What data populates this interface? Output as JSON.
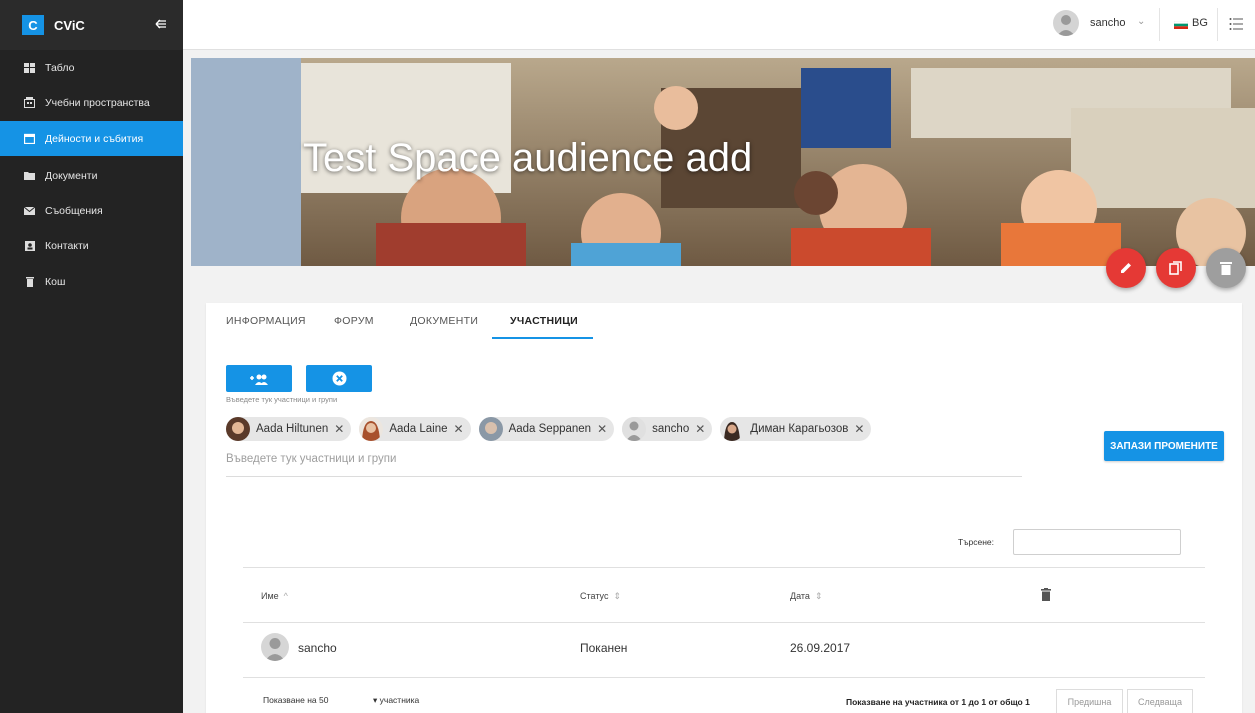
{
  "app": {
    "logo_letter": "C",
    "brand": "CViC"
  },
  "sidebar": {
    "items": [
      {
        "label": "Табло",
        "icon": "dashboard-icon"
      },
      {
        "label": "Учебни пространства",
        "icon": "building-icon"
      },
      {
        "label": "Дейности и събития",
        "icon": "calendar-icon",
        "active": true
      },
      {
        "label": "Документи",
        "icon": "folder-icon"
      },
      {
        "label": "Съобщения",
        "icon": "envelope-icon"
      },
      {
        "label": "Контакти",
        "icon": "contact-card-icon"
      },
      {
        "label": "Кош",
        "icon": "trash-icon"
      }
    ]
  },
  "topbar": {
    "user": "sancho",
    "lang": "BG"
  },
  "banner": {
    "title": "Test Space audience add"
  },
  "tabs": [
    {
      "label": "ИНФОРМАЦИЯ"
    },
    {
      "label": "ФОРУМ"
    },
    {
      "label": "ДОКУМЕНТИ"
    },
    {
      "label": "УЧАСТНИЦИ",
      "active": true
    }
  ],
  "audience": {
    "hint": "Въведете тук участници и групи",
    "placeholder": "Въведете тук участници и групи",
    "chips": [
      {
        "name": "Aada Hiltunen"
      },
      {
        "name": "Aada Laine"
      },
      {
        "name": "Aada Seppanen"
      },
      {
        "name": "sancho"
      },
      {
        "name": "Диман Карагьозов"
      }
    ],
    "save_label": "ЗАПАЗИ ПРОМЕНИТЕ"
  },
  "table": {
    "search_label": "Търсене:",
    "headers": {
      "name": "Име",
      "status": "Статус",
      "date": "Дата"
    },
    "rows": [
      {
        "name": "sancho",
        "status": "Поканен",
        "date": "26.09.2017"
      }
    ],
    "show_label": "Показване на",
    "page_size": "50",
    "unit_label": "участника",
    "info": "Показване на участника от 1 до 1 от общо 1",
    "prev": "Предишна",
    "next": "Следваща"
  },
  "colors": {
    "accent": "#1593e5",
    "sidebar_bg": "#232323",
    "fab_red": "#e53935",
    "fab_grey": "#9e9e9e"
  }
}
